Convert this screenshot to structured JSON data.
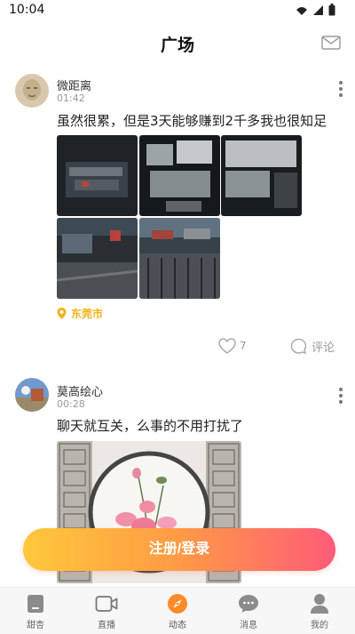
{
  "status": {
    "time": "10:04"
  },
  "header": {
    "title": "广场"
  },
  "posts": [
    {
      "user": "微距离",
      "time": "01:42",
      "text": "虽然很累，但是3天能够赚到2千多我也很知足",
      "location": "东莞市",
      "likes": "7",
      "comment_label": "评论"
    },
    {
      "user": "莫高绘心",
      "time": "00:28",
      "text": "聊天就互关，么事的不用打扰了"
    }
  ],
  "cta": {
    "label": "注册/登录"
  },
  "tabs": [
    {
      "label": "甜杏",
      "icon": "home-icon"
    },
    {
      "label": "直播",
      "icon": "video-camera-icon"
    },
    {
      "label": "动态",
      "icon": "compass-icon"
    },
    {
      "label": "消息",
      "icon": "chat-bubble-icon"
    },
    {
      "label": "我的",
      "icon": "user-icon"
    }
  ],
  "colors": {
    "accent_yellow": "#f2b21c",
    "gradient_start": "#ffc83c",
    "gradient_end": "#ff5b79",
    "compass": "#ff8a2a"
  }
}
